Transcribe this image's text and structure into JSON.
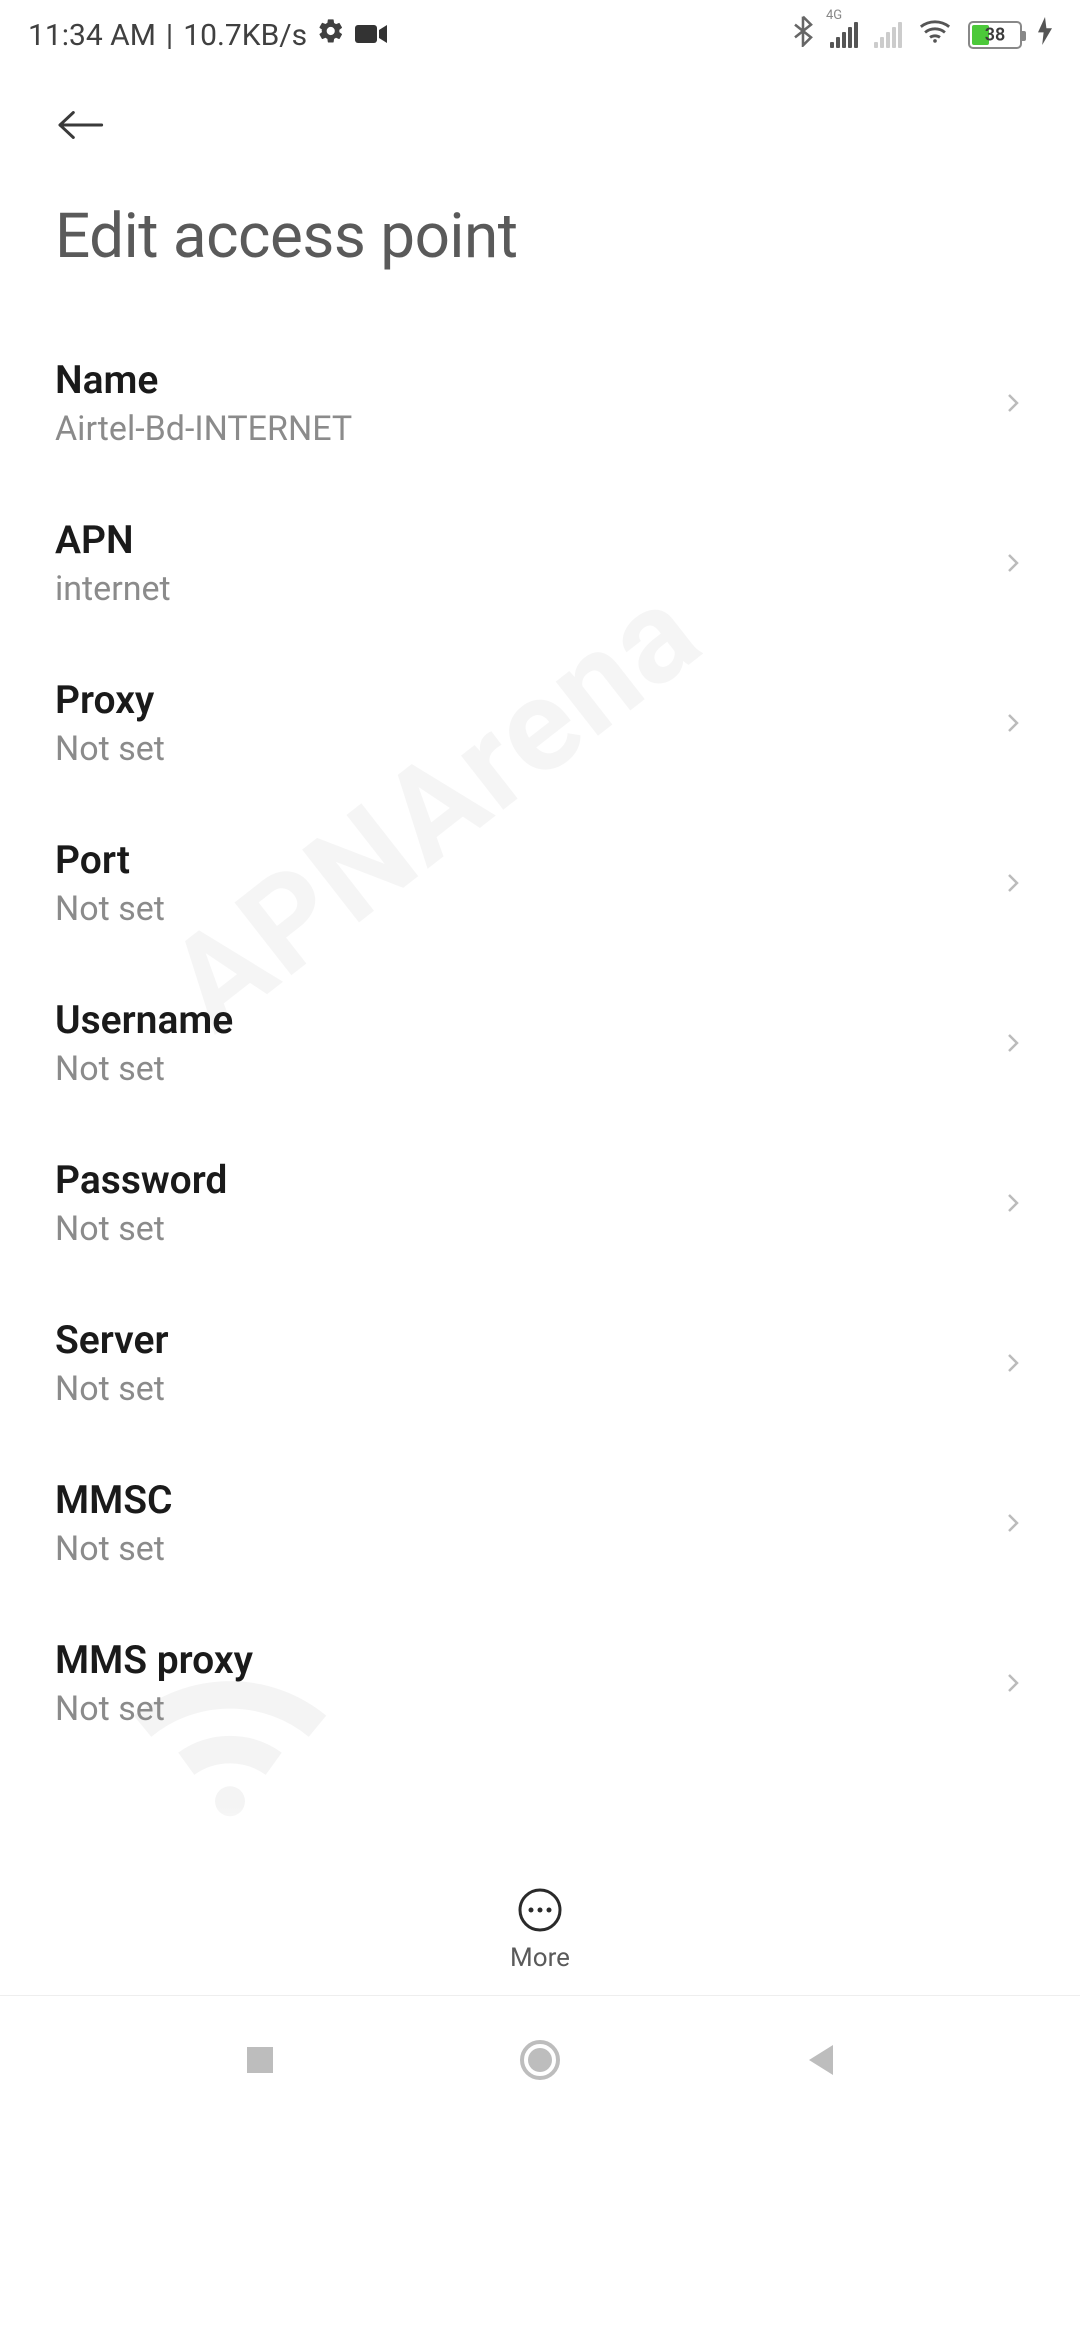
{
  "status": {
    "time": "11:34 AM",
    "separator": "|",
    "speed": "10.7KB/s",
    "battery_percent": "38",
    "network_label": "4G"
  },
  "header": {
    "title": "Edit access point"
  },
  "fields": [
    {
      "label": "Name",
      "value": "Airtel-Bd-INTERNET"
    },
    {
      "label": "APN",
      "value": "internet"
    },
    {
      "label": "Proxy",
      "value": "Not set"
    },
    {
      "label": "Port",
      "value": "Not set"
    },
    {
      "label": "Username",
      "value": "Not set"
    },
    {
      "label": "Password",
      "value": "Not set"
    },
    {
      "label": "Server",
      "value": "Not set"
    },
    {
      "label": "MMSC",
      "value": "Not set"
    },
    {
      "label": "MMS proxy",
      "value": "Not set"
    }
  ],
  "bottom": {
    "more_label": "More"
  },
  "watermark": {
    "text": "APNArena"
  }
}
